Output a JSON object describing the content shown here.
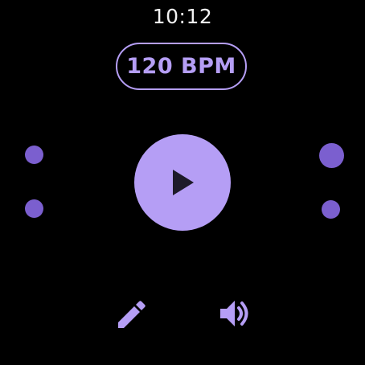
{
  "status": {
    "time": "10:12"
  },
  "tempo": {
    "bpm_label": "120 BPM"
  },
  "controls": {
    "play_icon": "play-icon",
    "edit_icon": "pencil-icon",
    "volume_icon": "volume-icon"
  },
  "colors": {
    "accent": "#b59ef5",
    "accent_dark": "#7b5fcf",
    "background": "#000000",
    "icon_dark": "#1e1b2a"
  }
}
